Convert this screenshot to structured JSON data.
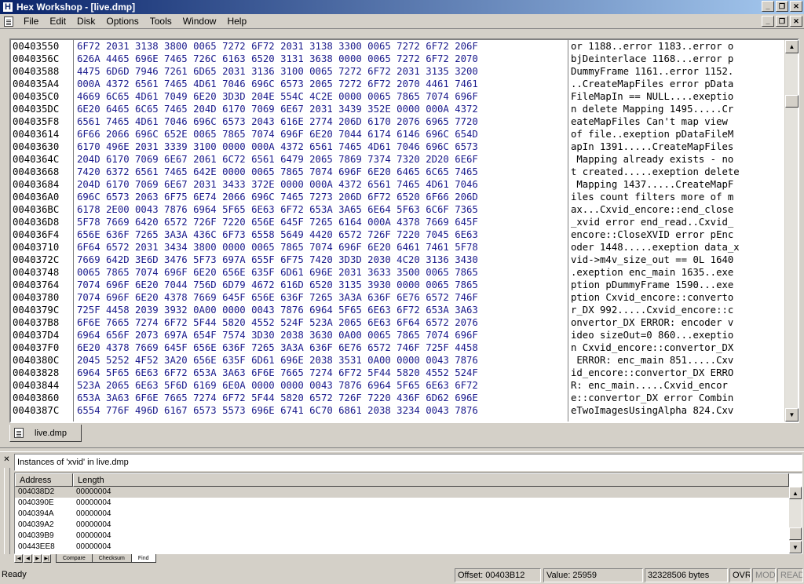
{
  "window": {
    "title": "Hex Workshop - [live.dmp]",
    "app_icon_glyph": "H"
  },
  "menu": [
    "File",
    "Edit",
    "Disk",
    "Options",
    "Tools",
    "Window",
    "Help"
  ],
  "hex_rows": [
    {
      "addr": "00403550",
      "hex": "6F72 2031 3138 3800 0065 7272 6F72 2031 3138 3300 0065 7272 6F72 206F",
      "ascii": "or 1188..error 1183..error o"
    },
    {
      "addr": "0040356C",
      "hex": "626A 4465 696E 7465 726C 6163 6520 3131 3638 0000 0065 7272 6F72 2070",
      "ascii": "bjDeinterlace 1168...error p"
    },
    {
      "addr": "00403588",
      "hex": "4475 6D6D 7946 7261 6D65 2031 3136 3100 0065 7272 6F72 2031 3135 3200",
      "ascii": "DummyFrame 1161..error 1152."
    },
    {
      "addr": "004035A4",
      "hex": "000A 4372 6561 7465 4D61 7046 696C 6573 2065 7272 6F72 2070 4461 7461",
      "ascii": "..CreateMapFiles error pData"
    },
    {
      "addr": "004035C0",
      "hex": "4669 6C65 4D61 7049 6E20 3D3D 204E 554C 4C2E 0000 0065 7865 7074 696F",
      "ascii": "FileMapIn == NULL....exeptio"
    },
    {
      "addr": "004035DC",
      "hex": "6E20 6465 6C65 7465 204D 6170 7069 6E67 2031 3439 352E 0000 000A 4372",
      "ascii": "n delete Mapping 1495.....Cr"
    },
    {
      "addr": "004035F8",
      "hex": "6561 7465 4D61 7046 696C 6573 2043 616E 2774 206D 6170 2076 6965 7720",
      "ascii": "eateMapFiles Can't map view "
    },
    {
      "addr": "00403614",
      "hex": "6F66 2066 696C 652E 0065 7865 7074 696F 6E20 7044 6174 6146 696C 654D",
      "ascii": "of file..exeption pDataFileM"
    },
    {
      "addr": "00403630",
      "hex": "6170 496E 2031 3339 3100 0000 000A 4372 6561 7465 4D61 7046 696C 6573",
      "ascii": "apIn 1391.....CreateMapFiles"
    },
    {
      "addr": "0040364C",
      "hex": "204D 6170 7069 6E67 2061 6C72 6561 6479 2065 7869 7374 7320 2D20 6E6F",
      "ascii": " Mapping already exists - no"
    },
    {
      "addr": "00403668",
      "hex": "7420 6372 6561 7465 642E 0000 0065 7865 7074 696F 6E20 6465 6C65 7465",
      "ascii": "t created.....exeption delete"
    },
    {
      "addr": "00403684",
      "hex": "204D 6170 7069 6E67 2031 3433 372E 0000 000A 4372 6561 7465 4D61 7046",
      "ascii": " Mapping 1437.....CreateMapF"
    },
    {
      "addr": "004036A0",
      "hex": "696C 6573 2063 6F75 6E74 2066 696C 7465 7273 206D 6F72 6520 6F66 206D",
      "ascii": "iles count filters more of m"
    },
    {
      "addr": "004036BC",
      "hex": "6178 2E00 0043 7876 6964 5F65 6E63 6F72 653A 3A65 6E64 5F63 6C6F 7365",
      "ascii": "ax...Cxvid_encore::end_close"
    },
    {
      "addr": "004036D8",
      "hex": "5F78 7669 6420 6572 726F 7220 656E 645F 7265 6164 000A 4378 7669 645F",
      "ascii": "_xvid error end_read..Cxvid_"
    },
    {
      "addr": "004036F4",
      "hex": "656E 636F 7265 3A3A 436C 6F73 6558 5649 4420 6572 726F 7220 7045 6E63",
      "ascii": "encore::CloseXVID error pEnc"
    },
    {
      "addr": "00403710",
      "hex": "6F64 6572 2031 3434 3800 0000 0065 7865 7074 696F 6E20 6461 7461 5F78",
      "ascii": "oder 1448.....exeption data_x"
    },
    {
      "addr": "0040372C",
      "hex": "7669 642D 3E6D 3476 5F73 697A 655F 6F75 7420 3D3D 2030 4C20 3136 3430",
      "ascii": "vid->m4v_size_out == 0L 1640"
    },
    {
      "addr": "00403748",
      "hex": "0065 7865 7074 696F 6E20 656E 635F 6D61 696E 2031 3633 3500 0065 7865",
      "ascii": ".exeption enc_main 1635..exe"
    },
    {
      "addr": "00403764",
      "hex": "7074 696F 6E20 7044 756D 6D79 4672 616D 6520 3135 3930 0000 0065 7865",
      "ascii": "ption pDummyFrame 1590...exe"
    },
    {
      "addr": "00403780",
      "hex": "7074 696F 6E20 4378 7669 645F 656E 636F 7265 3A3A 636F 6E76 6572 746F",
      "ascii": "ption Cxvid_encore::converto"
    },
    {
      "addr": "0040379C",
      "hex": "725F 4458 2039 3932 0A00 0000 0043 7876 6964 5F65 6E63 6F72 653A 3A63",
      "ascii": "r_DX 992.....Cxvid_encore::c"
    },
    {
      "addr": "004037B8",
      "hex": "6F6E 7665 7274 6F72 5F44 5820 4552 524F 523A 2065 6E63 6F64 6572 2076",
      "ascii": "onvertor_DX ERROR: encoder v"
    },
    {
      "addr": "004037D4",
      "hex": "6964 656F 2073 697A 654F 7574 3D30 2038 3630 0A00 0065 7865 7074 696F",
      "ascii": "ideo sizeOut=0 860...exeptio"
    },
    {
      "addr": "004037F0",
      "hex": "6E20 4378 7669 645F 656E 636F 7265 3A3A 636F 6E76 6572 746F 725F 4458",
      "ascii": "n Cxvid_encore::convertor_DX"
    },
    {
      "addr": "0040380C",
      "hex": "2045 5252 4F52 3A20 656E 635F 6D61 696E 2038 3531 0A00 0000 0043 7876",
      "ascii": " ERROR: enc_main 851.....Cxv"
    },
    {
      "addr": "00403828",
      "hex": "6964 5F65 6E63 6F72 653A 3A63 6F6E 7665 7274 6F72 5F44 5820 4552 524F",
      "ascii": "id_encore::convertor_DX ERRO"
    },
    {
      "addr": "00403844",
      "hex": "523A 2065 6E63 5F6D 6169 6E0A 0000 0000 0043 7876 6964 5F65 6E63 6F72",
      "ascii": "R: enc_main.....Cxvid_encor"
    },
    {
      "addr": "00403860",
      "hex": "653A 3A63 6F6E 7665 7274 6F72 5F44 5820 6572 726F 7220 436F 6D62 696E",
      "ascii": "e::convertor_DX error Combin"
    },
    {
      "addr": "0040387C",
      "hex": "6554 776F 496D 6167 6573 5573 696E 6741 6C70 6861 2038 3234 0043 7876",
      "ascii": "eTwoImagesUsingAlpha 824.Cxv"
    }
  ],
  "doc_tab": {
    "label": "live.dmp"
  },
  "find_pane": {
    "title": "Instances of 'xvid' in live.dmp",
    "columns": [
      "Address",
      "Length"
    ],
    "rows": [
      {
        "address": "004038D2",
        "length": "00000004"
      },
      {
        "address": "0040390E",
        "length": "00000004"
      },
      {
        "address": "0040394A",
        "length": "00000004"
      },
      {
        "address": "004039A2",
        "length": "00000004"
      },
      {
        "address": "004039B9",
        "length": "00000004"
      },
      {
        "address": "00443EE8",
        "length": "00000004"
      }
    ]
  },
  "bottom_tabs": [
    "Compare",
    "Checksum",
    "Find"
  ],
  "status": {
    "ready": "Ready",
    "offset": "Offset: 00403B12",
    "value": "Value: 25959",
    "size": "32328506 bytes",
    "ovr": "OVR",
    "mod": "MOD",
    "read": "READ"
  }
}
